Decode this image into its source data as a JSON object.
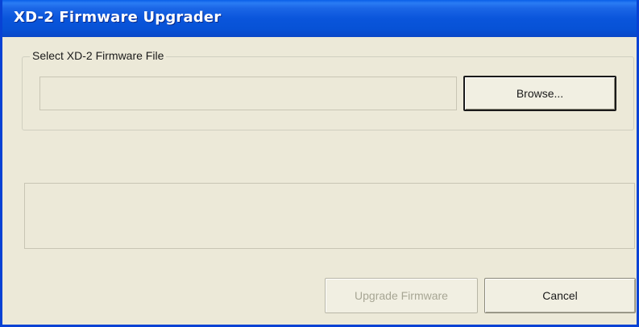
{
  "window": {
    "title": "XD-2 Firmware Upgrader"
  },
  "file_group": {
    "label": "Select XD-2 Firmware File",
    "file_path_value": "",
    "browse_label": "Browse..."
  },
  "status": {
    "text": ""
  },
  "actions": {
    "upgrade_label": "Upgrade Firmware",
    "upgrade_enabled": false,
    "cancel_label": "Cancel"
  },
  "colors": {
    "title_bar": "#0a55db",
    "window_bg": "#ece9d8",
    "disabled_text": "#a7a694"
  }
}
